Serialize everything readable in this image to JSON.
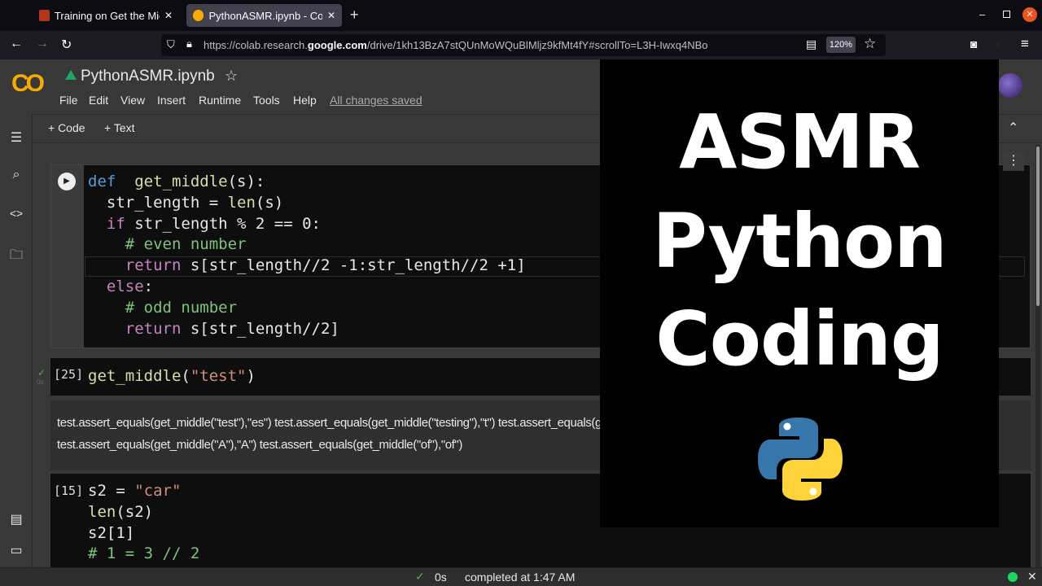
{
  "browser": {
    "tabs": [
      {
        "title": "Training on Get the Midd",
        "active": false
      },
      {
        "title": "PythonASMR.ipynb - Cola",
        "active": true
      }
    ],
    "url_prefix": "https://colab.research.",
    "url_domain": "google.com",
    "url_path": "/drive/1kh13BzA7stQUnMoWQuBlMljz9kfMt4fY#scrollTo=L3H-Iwxq4NBo",
    "zoom": "120%"
  },
  "colab": {
    "logo": "CO",
    "notebook_title": "PythonASMR.ipynb",
    "menu": [
      "File",
      "Edit",
      "View",
      "Insert",
      "Runtime",
      "Tools",
      "Help"
    ],
    "save_status": "All changes saved",
    "toolbar": {
      "add_code": "+ Code",
      "add_text": "+ Text"
    }
  },
  "cells": {
    "def_cell": [
      [
        [
          "kw",
          "def"
        ],
        [
          "",
          "  "
        ],
        [
          "fn",
          "get_middle"
        ],
        [
          "",
          "(s):"
        ]
      ],
      [
        [
          "",
          "  str_length = "
        ],
        [
          "fn",
          "len"
        ],
        [
          "",
          "(s)"
        ]
      ],
      [
        [
          "",
          "  "
        ],
        [
          "kp",
          "if"
        ],
        [
          "",
          " str_length % 2 == 0:"
        ]
      ],
      [
        [
          "cm",
          "    # even number"
        ]
      ],
      [
        [
          "",
          "    "
        ],
        [
          "kp",
          "return"
        ],
        [
          "",
          " s[str_length//2 -1:str_length//2 +1]"
        ]
      ],
      [
        [
          "",
          "  "
        ],
        [
          "kp",
          "else"
        ],
        [
          "",
          ":"
        ]
      ],
      [
        [
          "cm",
          "    # odd number"
        ]
      ],
      [
        [
          "",
          "    "
        ],
        [
          "kp",
          "return"
        ],
        [
          "",
          " s[str_length//2]"
        ]
      ]
    ],
    "call_cell": {
      "exec_count": "[25]",
      "exec_time": "0s",
      "code": [
        [
          [
            "fn",
            "get_middle"
          ],
          [
            "",
            "("
          ],
          [
            "st",
            "\"test\""
          ],
          [
            "",
            ")"
          ]
        ]
      ]
    },
    "text_cell": [
      "test.assert_equals(get_middle(\"test\"),\"es\") test.assert_equals(get_middle(\"testing\"),\"t\") test.assert_equals(get_middle(\"middle\"),\"dd\")",
      "test.assert_equals(get_middle(\"A\"),\"A\") test.assert_equals(get_middle(\"of\"),\"of\")"
    ],
    "s2_cell": {
      "exec_count": "[15]",
      "code": [
        [
          [
            "",
            "s2 = "
          ],
          [
            "st",
            "\"car\""
          ]
        ],
        [
          [
            "fn",
            "len"
          ],
          [
            "",
            "(s2)"
          ]
        ],
        [
          [
            "",
            "s2[1]"
          ]
        ],
        [
          [
            "cm",
            "# 1 = 3 // 2"
          ]
        ]
      ]
    }
  },
  "overlay": {
    "line1": "ASMR",
    "line2": "Python",
    "line3": "Coding"
  },
  "status": {
    "time": "0s",
    "text": "completed at 1:47 AM"
  },
  "colors": {
    "accent_orange": "#f9ab00",
    "python_blue": "#3776ab",
    "python_yellow": "#ffd43b"
  }
}
